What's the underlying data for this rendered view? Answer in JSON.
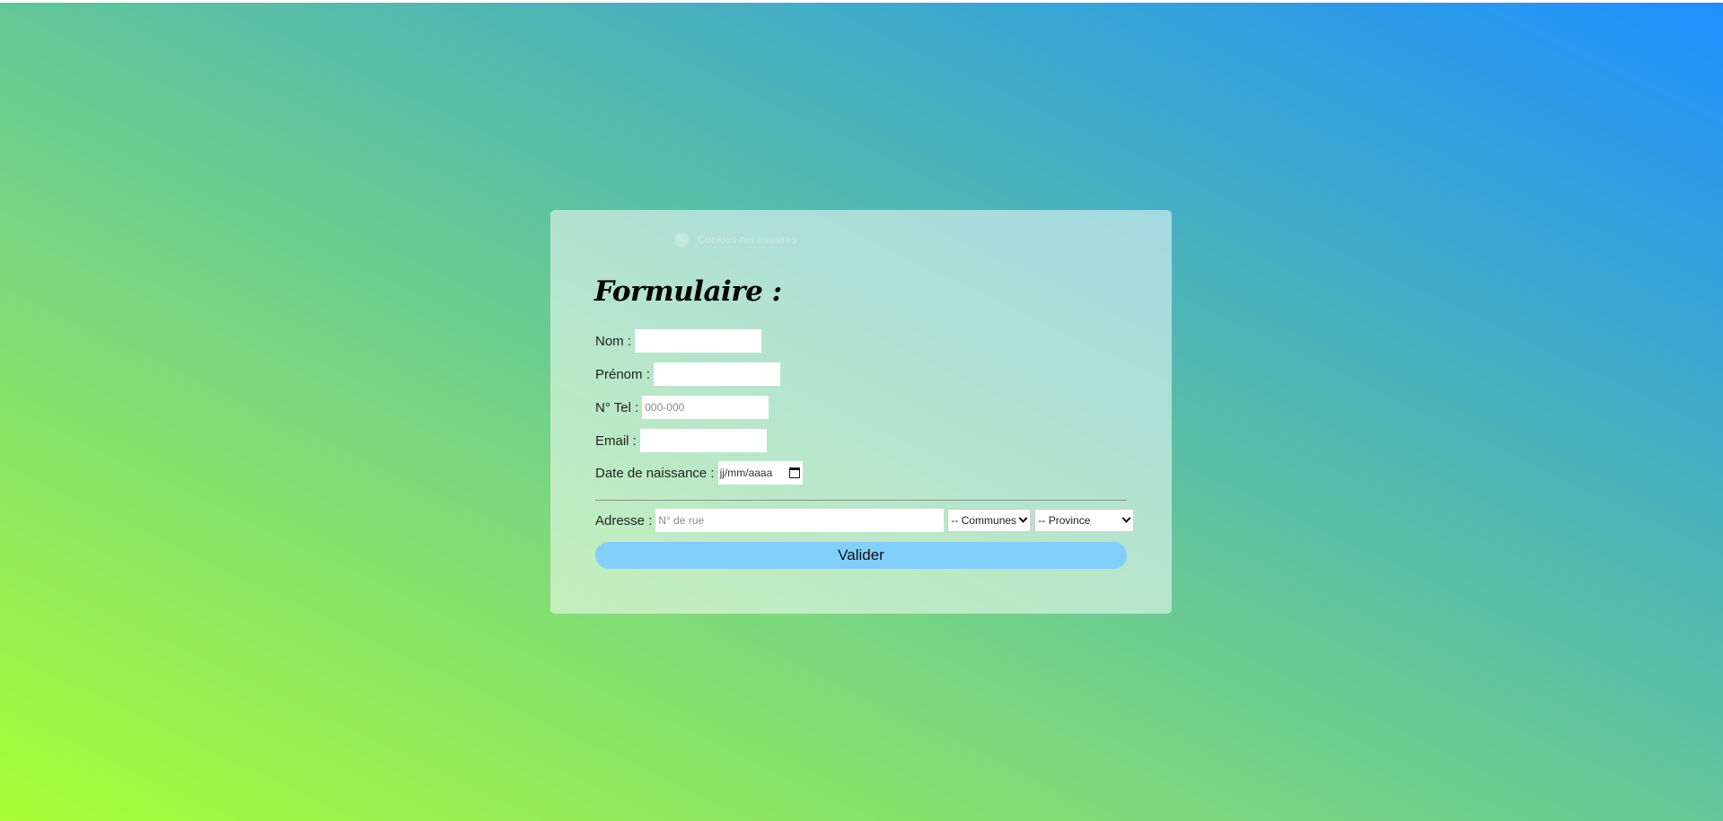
{
  "form": {
    "title": "Formulaire :",
    "fields": {
      "nom": {
        "label": "Nom :",
        "value": "",
        "placeholder": ""
      },
      "prenom": {
        "label": "Prénom :",
        "value": "",
        "placeholder": ""
      },
      "tel": {
        "label": "N° Tel :",
        "value": "",
        "placeholder": "000-000"
      },
      "email": {
        "label": "Email :",
        "value": "",
        "placeholder": ""
      },
      "naissance": {
        "label": "Date de naissance :",
        "display": "jj/mm/aaaa",
        "icon": "calendar-icon"
      }
    },
    "adresse": {
      "label": "Adresse :",
      "rue_placeholder": "N° de rue",
      "communes_selected": "-- Communes",
      "province_selected": "-- Province"
    },
    "submit_label": "Valider"
  },
  "toast": {
    "text": "Cookies nécessaires"
  },
  "colors": {
    "gradient_start": "#a8ff36",
    "gradient_end": "#1e90ff",
    "button": "#81cffa"
  }
}
